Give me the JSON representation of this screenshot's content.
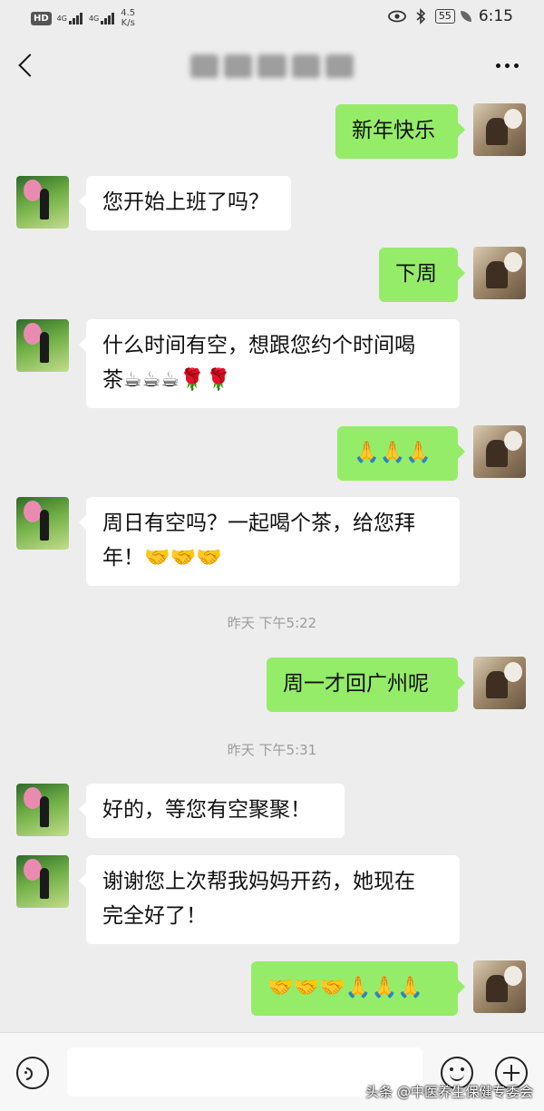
{
  "status_bar": {
    "hd": "HD",
    "net1": "4G",
    "net2": "4G",
    "speed_value": "4.5",
    "speed_unit": "K/s",
    "battery": "55",
    "time": "6:15",
    "icons": [
      "eye-icon",
      "bluetooth-icon",
      "battery-icon",
      "leaf-icon"
    ]
  },
  "nav": {
    "title": "",
    "back_icon": "chevron-left-icon",
    "more_icon": "more-dots-icon"
  },
  "messages": [
    {
      "side": "right",
      "text": "新年快乐"
    },
    {
      "side": "left",
      "text": "您开始上班了吗？"
    },
    {
      "side": "right",
      "text": "下周"
    },
    {
      "side": "left",
      "text": "什么时间有空，想跟您约个时间喝\n茶☕☕☕🌹🌹"
    },
    {
      "side": "right",
      "text": "🙏🙏🙏"
    },
    {
      "side": "left",
      "text": "周日有空吗？一起喝个茶，给您拜\n年！🤝🤝🤝"
    },
    {
      "side": "right",
      "text": "周一才回广州呢"
    },
    {
      "side": "left",
      "text": "好的，等您有空聚聚！"
    },
    {
      "side": "left",
      "text": "谢谢您上次帮我妈妈开药，她现在\n完全好了！"
    },
    {
      "side": "right",
      "text": "🤝🤝🤝🙏🙏🙏"
    }
  ],
  "timestamps": [
    "昨天 下午5:22",
    "昨天 下午5:31"
  ],
  "input_bar": {
    "placeholder": "",
    "icons": [
      "voice-icon",
      "emoji-icon",
      "plus-icon"
    ]
  },
  "watermark": "头条 @中医养生保健专委会",
  "colors": {
    "background": "#ededed",
    "self_bubble": "#95ec69",
    "other_bubble": "#ffffff"
  }
}
